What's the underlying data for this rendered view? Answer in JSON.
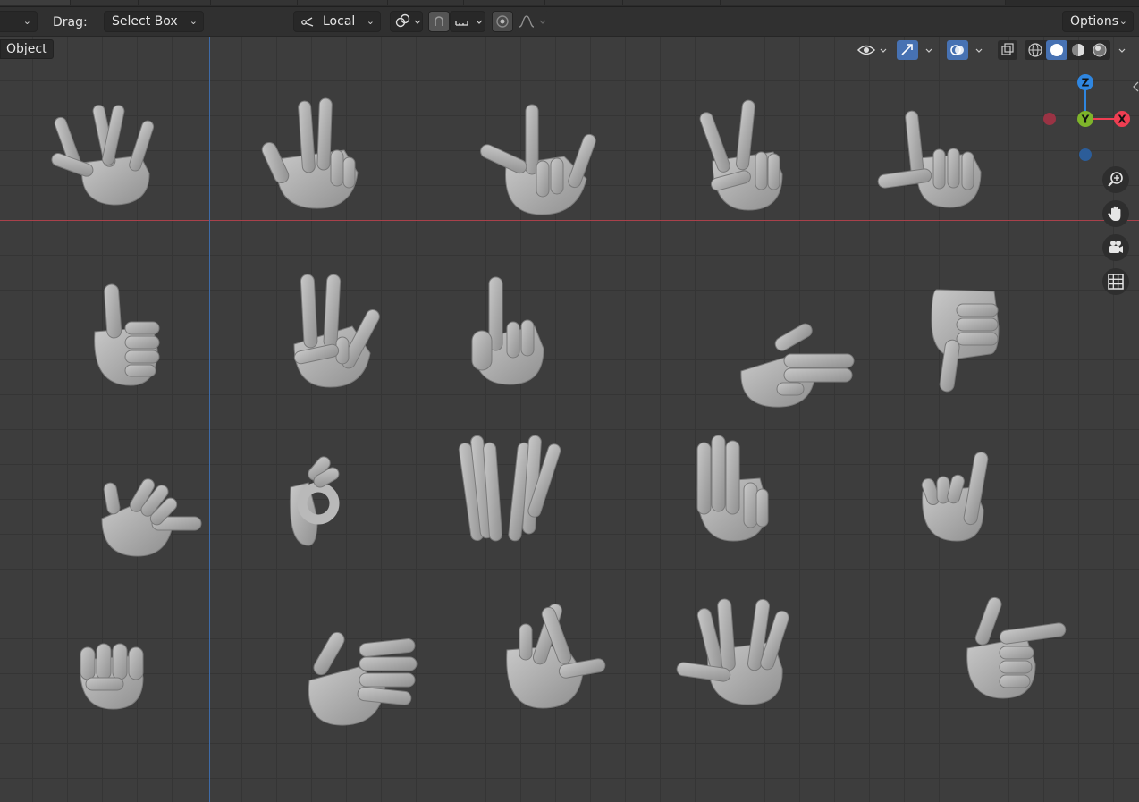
{
  "header": {
    "mode_dropdown_label": "",
    "drag_label": "Drag:",
    "drag_value": "Select Box",
    "transform_orientation": "Local",
    "options_label": "Options"
  },
  "viewport": {
    "mode_badge": "Object",
    "gizmo": {
      "z": "Z",
      "y": "Y",
      "x": "X"
    },
    "axis_colors": {
      "x": "#f03e52",
      "y": "#7eb42a",
      "z": "#2f86e0"
    }
  },
  "icons": [
    "chevron-down-icon",
    "pivot-local-icon",
    "snap-icon",
    "proportional-edit-icon",
    "falloff-curve-icon",
    "eye-icon",
    "gizmo-arrow-icon",
    "overlay-icon",
    "xray-icon",
    "wireframe-shading-icon",
    "solid-shading-icon",
    "material-shading-icon",
    "rendered-shading-icon",
    "zoom-icon",
    "hand-pan-icon",
    "camera-icon",
    "grid-icon"
  ]
}
